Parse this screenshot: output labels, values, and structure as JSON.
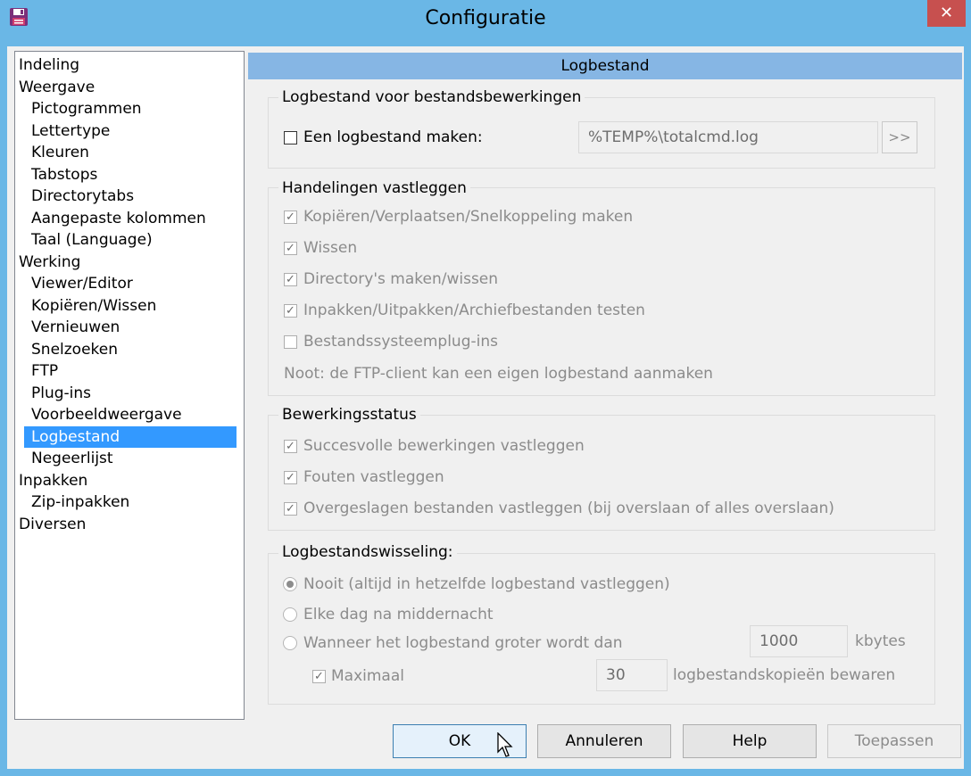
{
  "window": {
    "title": "Configuratie",
    "close_symbol": "✕"
  },
  "tree": {
    "items": [
      {
        "label": "Indeling",
        "level": 0
      },
      {
        "label": "Weergave",
        "level": 0
      },
      {
        "label": "Pictogrammen",
        "level": 1
      },
      {
        "label": "Lettertype",
        "level": 1
      },
      {
        "label": "Kleuren",
        "level": 1
      },
      {
        "label": "Tabstops",
        "level": 1
      },
      {
        "label": "Directorytabs",
        "level": 1
      },
      {
        "label": "Aangepaste kolommen",
        "level": 1
      },
      {
        "label": "Taal (Language)",
        "level": 1
      },
      {
        "label": "Werking",
        "level": 0
      },
      {
        "label": "Viewer/Editor",
        "level": 1
      },
      {
        "label": "Kopiëren/Wissen",
        "level": 1
      },
      {
        "label": "Vernieuwen",
        "level": 1
      },
      {
        "label": "Snelzoeken",
        "level": 1
      },
      {
        "label": "FTP",
        "level": 1
      },
      {
        "label": "Plug-ins",
        "level": 1
      },
      {
        "label": "Voorbeeldweergave",
        "level": 1
      },
      {
        "label": "Logbestand",
        "level": 1,
        "selected": true
      },
      {
        "label": "Negeerlijst",
        "level": 1
      },
      {
        "label": "Inpakken",
        "level": 0
      },
      {
        "label": "Zip-inpakken",
        "level": 1
      },
      {
        "label": "Diversen",
        "level": 0
      }
    ]
  },
  "panel": {
    "header": "Logbestand",
    "logfile_group": {
      "title": "Logbestand voor bestandsbewerkingen",
      "create_label": "Een logbestand maken:",
      "create_checked": false,
      "path_value": "%TEMP%\\totalcmd.log",
      "browse_label": ">>"
    },
    "actions_group": {
      "title": "Handelingen vastleggen",
      "items": [
        {
          "label": "Kopiëren/Verplaatsen/Snelkoppeling maken",
          "checked": true
        },
        {
          "label": "Wissen",
          "checked": true
        },
        {
          "label": "Directory's maken/wissen",
          "checked": true
        },
        {
          "label": "Inpakken/Uitpakken/Archiefbestanden testen",
          "checked": true
        },
        {
          "label": "Bestandssysteemplug-ins",
          "checked": false
        }
      ],
      "note": "Noot: de FTP-client kan een eigen logbestand aanmaken"
    },
    "status_group": {
      "title": "Bewerkingsstatus",
      "items": [
        {
          "label": "Succesvolle bewerkingen vastleggen",
          "checked": true
        },
        {
          "label": "Fouten vastleggen",
          "checked": true
        },
        {
          "label": "Overgeslagen bestanden vastleggen (bij overslaan of alles overslaan)",
          "checked": true
        }
      ]
    },
    "rotation_group": {
      "title": "Logbestandswisseling:",
      "options": [
        {
          "label": "Nooit (altijd in hetzelfde logbestand vastleggen)",
          "selected": true
        },
        {
          "label": "Elke dag na middernacht",
          "selected": false
        },
        {
          "label": "Wanneer het logbestand groter wordt dan",
          "selected": false
        }
      ],
      "size_value": "1000",
      "size_unit": "kbytes",
      "max_label": "Maximaal",
      "max_checked": true,
      "copies_value": "30",
      "copies_label": "logbestandskopieën bewaren"
    }
  },
  "buttons": {
    "ok": "OK",
    "cancel": "Annuleren",
    "help": "Help",
    "apply": "Toepassen"
  },
  "colors": {
    "titlebar": "#6ab7e6",
    "close": "#c7504f",
    "selection": "#3399ff",
    "panel_header": "#86b6e4"
  }
}
